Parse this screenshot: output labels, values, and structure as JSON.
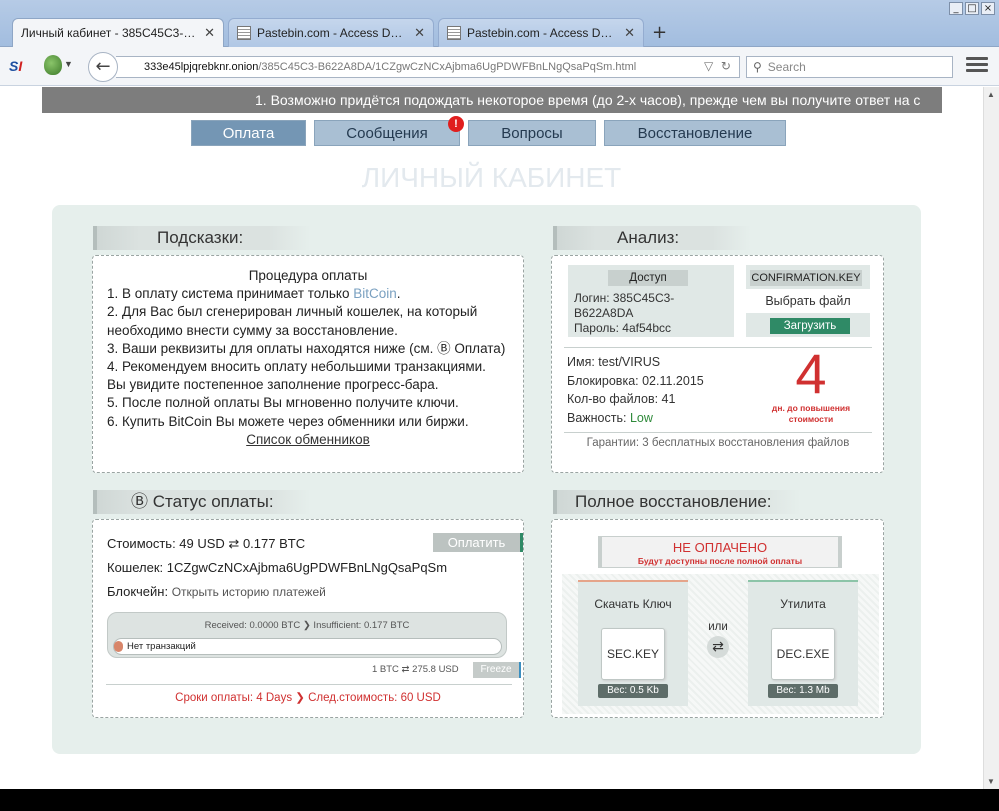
{
  "browser": {
    "tabs": [
      {
        "label": "Личный кабинет - 385C45C3-B6..."
      },
      {
        "label": "Pastebin.com - Access Denied..."
      },
      {
        "label": "Pastebin.com - Access Denied..."
      }
    ],
    "window_controls": [
      "_",
      "□",
      "×"
    ],
    "new_tab": "+",
    "url_host": "333e45lpjqrebknr.onion",
    "url_path": "/385C45C3-B622A8DA/1CZgwCzNCxAjbma6UgPDWFBnLNgQsaPqSm.html",
    "search_placeholder": "Search"
  },
  "ticker": "1. Возможно придётся подождать некоторое время (до 2-х часов), прежде чем вы получите ответ на с",
  "nav": {
    "tabs": [
      "Оплата",
      "Сообщения",
      "Вопросы",
      "Восстановление"
    ],
    "badge": "!"
  },
  "page_title": "ЛИЧНЫЙ КАБИНЕТ",
  "hints": {
    "header": "Подсказки:",
    "title": "Процедура оплаты",
    "l1a": "1. В оплату система принимает только ",
    "l1b": "BitCoin",
    "l1c": ".",
    "l2a": "2. Для Вас был сгенерирован личный кошелек, на который",
    "l2b": "необходимо внести сумму за восстановление.",
    "l3": "3. Ваши реквизиты для оплаты находятся ниже (см. Ⓑ Оплата)",
    "l4a": "4. Рекомендуем вносить оплату небольшими транзакциями.",
    "l4b": "Вы увидите постепенное заполнение прогресс-бара.",
    "l5": "5. После полной оплаты Вы мгновенно получите ключи.",
    "l6": "6. Купить BitCoin Вы можете через обменники или биржи.",
    "link": "Список обменников"
  },
  "analysis": {
    "header": "Анализ:",
    "access_label": "Доступ",
    "login": "Логин: 385C45C3-",
    "login2": "B622A8DA",
    "password": "Пароль: 4af54bcc",
    "confirm_label": "CONFIRMATION.KEY",
    "choose_file": "Выбрать файл",
    "upload": "Загрузить",
    "name": "Имя: test/VIRUS",
    "blocked": "Блокировка: 02.11.2015",
    "files": "Кол-во файлов: 41",
    "importance_label": "Важность: ",
    "importance_value": "Low",
    "days": "4",
    "days_caption1": "дн. до повышения",
    "days_caption2": "стоимости",
    "guarantee": "Гарантии: 3 бесплатных восстановления файлов"
  },
  "status": {
    "header": "Статус оплаты:",
    "header_icon": "Ⓑ",
    "cost": "Стоимость: 49 USD  ⇄  0.177 BTC",
    "pay_button": "Оплатить",
    "wallet": "Кошелек:  1CZgwCzNCxAjbma6UgPDWFBnLNgQsaPqSm",
    "blockchain_label": "Блокчейн: ",
    "blockchain_link": "Открыть историю платежей",
    "received": "Received: 0.0000 BTC ❯ Insufficient: 0.177 BTC",
    "no_tx": "Нет транзакций",
    "rate": "1 BTC ⇄ 275.8 USD",
    "freeze": "Freeze",
    "deadline": "Сроки оплаты: 4 Days ❯ След.стоимость: 60 USD",
    "progress_fraction": 0
  },
  "recovery": {
    "header": "Полное восстановление:",
    "not_paid": "НЕ ОПЛАЧЕНО",
    "not_paid_sub": "Будут доступны после полной оплаты",
    "download_key": "Скачать Ключ",
    "or": "или",
    "utility": "Утилита",
    "key_file": "SEC.KEY",
    "key_size": "Вес: 0.5 Kb",
    "exe_file": "DEC.EXE",
    "exe_size": "Вес: 1.3 Mb"
  }
}
